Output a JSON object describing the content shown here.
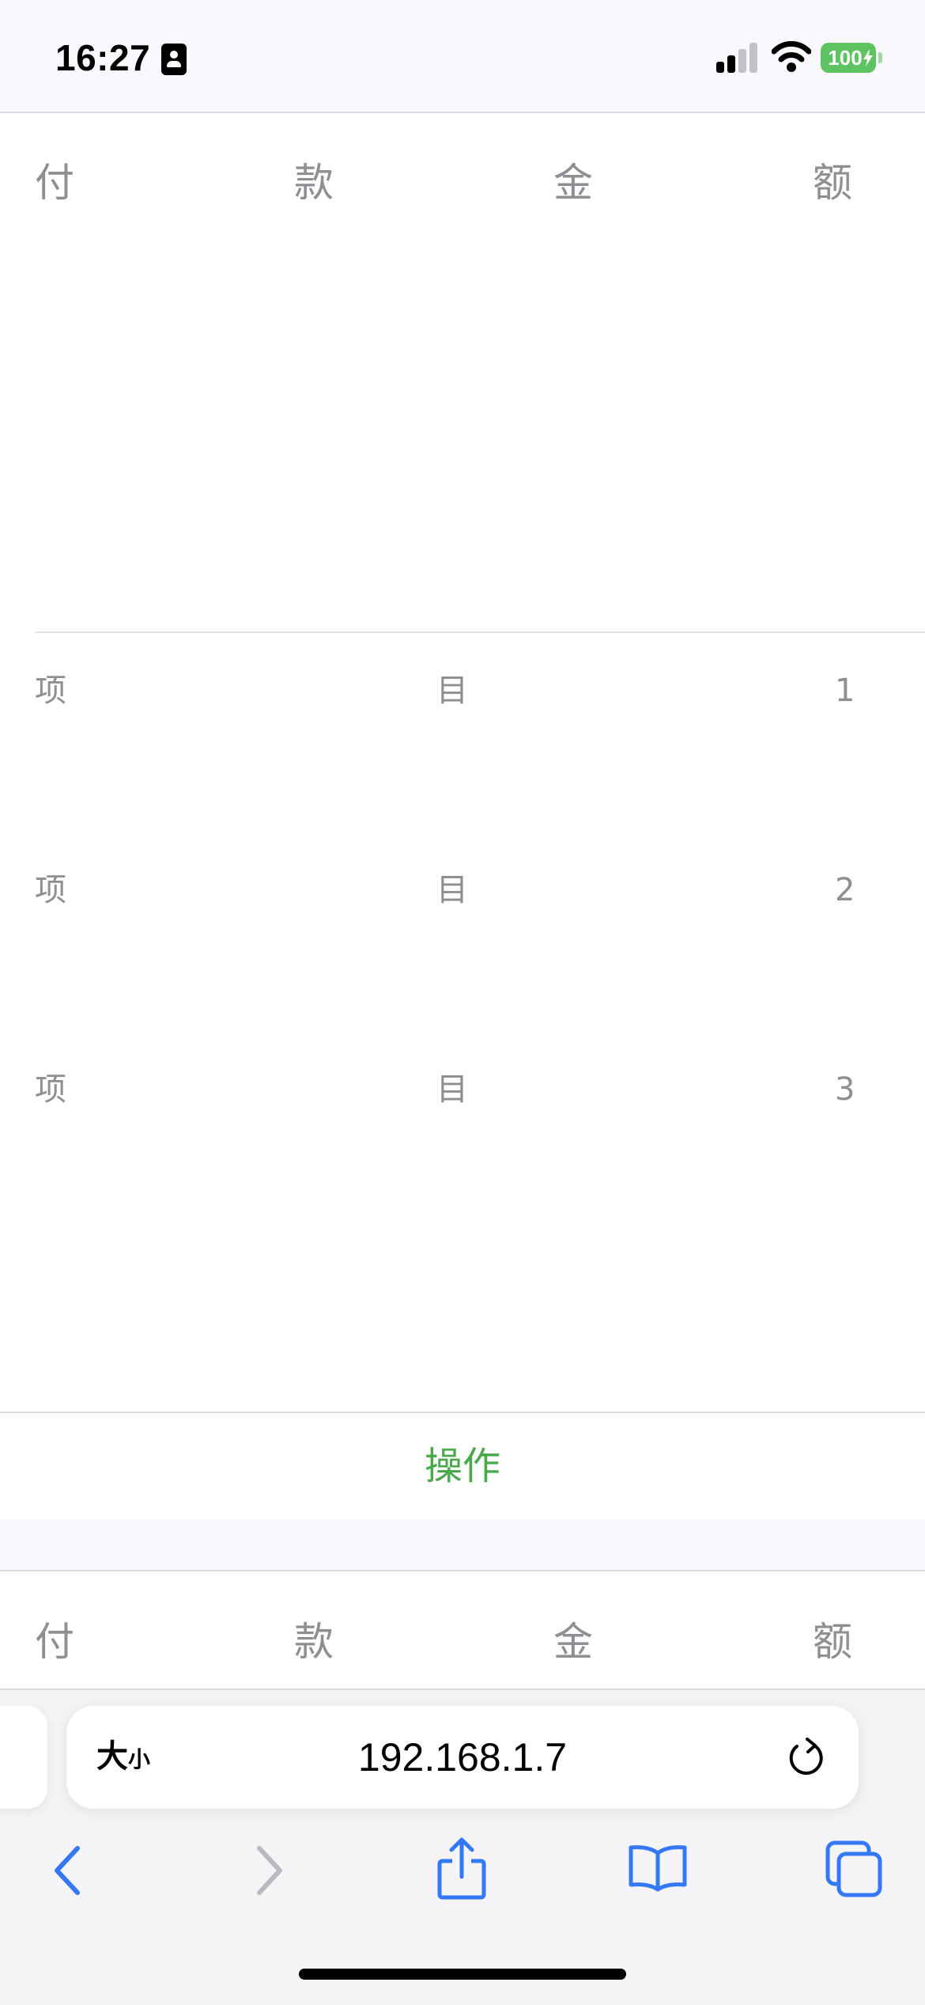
{
  "status_bar": {
    "time": "16:27",
    "battery": "100",
    "battery_color": "#5ec462",
    "icons": [
      "contact-card-icon",
      "cellular-signal-icon",
      "wifi-icon",
      "battery-charging-icon"
    ]
  },
  "sections": [
    {
      "header": [
        "付",
        "款",
        "金",
        "额"
      ],
      "items": [
        [
          "项",
          "目",
          "1"
        ],
        [
          "项",
          "目",
          "2"
        ],
        [
          "项",
          "目",
          "3"
        ]
      ],
      "action_label": "操作"
    },
    {
      "header": [
        "付",
        "款",
        "金",
        "额"
      ]
    }
  ],
  "colors": {
    "accent_green": "#4aa84b",
    "muted_text": "#8e8e93",
    "link_blue": "#3478f6"
  },
  "browser": {
    "reader_button_large": "大",
    "reader_button_small": "小",
    "url": "192.168.1.7",
    "toolbar_icons": [
      "back-icon",
      "forward-icon",
      "share-icon",
      "bookmarks-icon",
      "tabs-icon"
    ]
  }
}
